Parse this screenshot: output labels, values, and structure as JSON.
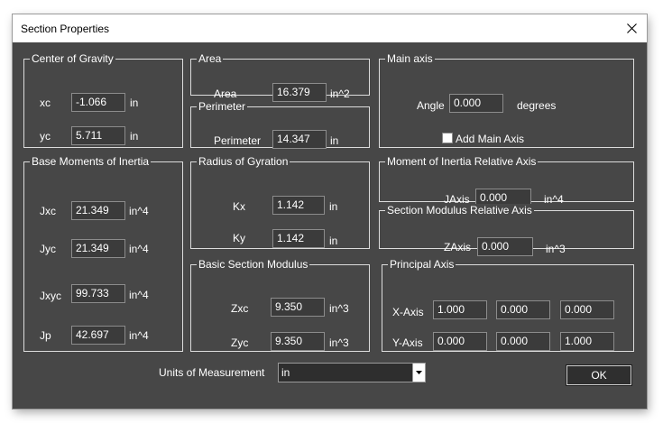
{
  "window": {
    "title": "Section Properties"
  },
  "center_of_gravity": {
    "legend": "Center of Gravity",
    "xc": {
      "label": "xc",
      "value": "-1.066",
      "unit": "in"
    },
    "yc": {
      "label": "yc",
      "value": "5.711",
      "unit": "in"
    }
  },
  "area": {
    "legend": "Area",
    "area": {
      "label": "Area",
      "value": "16.379",
      "unit": "in^2"
    }
  },
  "perimeter": {
    "legend": "Perimeter",
    "perimeter": {
      "label": "Perimeter",
      "value": "14.347",
      "unit": "in"
    }
  },
  "main_axis": {
    "legend": "Main axis",
    "angle": {
      "label": "Angle",
      "value": "0.000",
      "unit": "degrees"
    },
    "add_main_axis": {
      "label": "Add Main Axis",
      "checked": false
    }
  },
  "base_moments": {
    "legend": "Base Moments of Inertia",
    "jxc": {
      "label": "Jxc",
      "value": "21.349",
      "unit": "in^4"
    },
    "jyc": {
      "label": "Jyc",
      "value": "21.349",
      "unit": "in^4"
    },
    "jxyc": {
      "label": "Jxyc",
      "value": "99.733",
      "unit": "in^4"
    },
    "jp": {
      "label": "Jp",
      "value": "42.697",
      "unit": "in^4"
    }
  },
  "radius_gyration": {
    "legend": "Radius of Gyration",
    "kx": {
      "label": "Kx",
      "value": "1.142",
      "unit": "in"
    },
    "ky": {
      "label": "Ky",
      "value": "1.142",
      "unit": "in"
    }
  },
  "moi_relative": {
    "legend": "Moment of Inertia Relative Axis",
    "jaxis": {
      "label": "JAxis",
      "value": "0.000",
      "unit": "in^4"
    }
  },
  "modulus_relative": {
    "legend": "Section Modulus Relative Axis",
    "zaxis": {
      "label": "ZAxis",
      "value": "0.000",
      "unit": "in^3"
    }
  },
  "basic_modulus": {
    "legend": "Basic Section Modulus",
    "zxc": {
      "label": "Zxc",
      "value": "9.350",
      "unit": "in^3"
    },
    "zyc": {
      "label": "Zyc",
      "value": "9.350",
      "unit": "in^3"
    }
  },
  "principal_axis": {
    "legend": "Principal Axis",
    "x_axis": {
      "label": "X-Axis",
      "values": [
        "1.000",
        "0.000",
        "0.000"
      ]
    },
    "y_axis": {
      "label": "Y-Axis",
      "values": [
        "0.000",
        "0.000",
        "1.000"
      ]
    }
  },
  "units": {
    "label": "Units of Measurement",
    "selected": "in"
  },
  "ok_label": "OK",
  "colors": {
    "dialog_bg": "#474747",
    "field_bg": "#3b3b3b",
    "text": "#ffffff",
    "group_border": "#dcdcdc"
  }
}
